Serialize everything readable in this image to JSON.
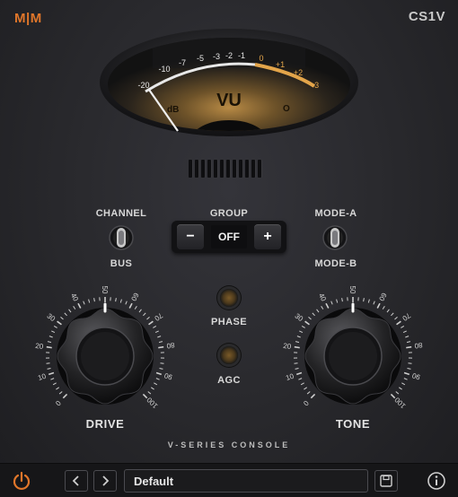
{
  "header": {
    "logo": "M|M",
    "product": "CS1V"
  },
  "meter": {
    "title": "VU",
    "scale_labels": [
      "-20",
      "-10",
      "-7",
      "-5",
      "-3",
      "-2",
      "-1",
      "0",
      "+1",
      "+2",
      "+3"
    ],
    "db_label": "dB",
    "peak_label": "O"
  },
  "channel_switch": {
    "top_label": "CHANNEL",
    "bottom_label": "BUS"
  },
  "group": {
    "label": "GROUP",
    "value": "OFF",
    "minus_label": "−",
    "plus_label": "+"
  },
  "mode_switch": {
    "top_label": "MODE-A",
    "bottom_label": "MODE-B"
  },
  "lamps": {
    "phase_label": "PHASE",
    "agc_label": "AGC"
  },
  "knobs": {
    "drive": {
      "label": "DRIVE",
      "scale": [
        "0",
        "10",
        "20",
        "30",
        "40",
        "50",
        "60",
        "70",
        "80",
        "90",
        "100"
      ],
      "value": 50
    },
    "tone": {
      "label": "TONE",
      "scale": [
        "0",
        "10",
        "20",
        "30",
        "40",
        "50",
        "60",
        "70",
        "80",
        "90",
        "100"
      ],
      "value": 50
    }
  },
  "footer_text": "V-SERIES CONSOLE",
  "bottombar": {
    "preset": "Default",
    "icons": [
      "power-icon",
      "chevron-left-icon",
      "chevron-right-icon",
      "save-icon",
      "info-icon"
    ]
  },
  "colors": {
    "accent": "#e0762a",
    "meter_amber": "#e3a54a",
    "text": "#d8d8d8"
  }
}
